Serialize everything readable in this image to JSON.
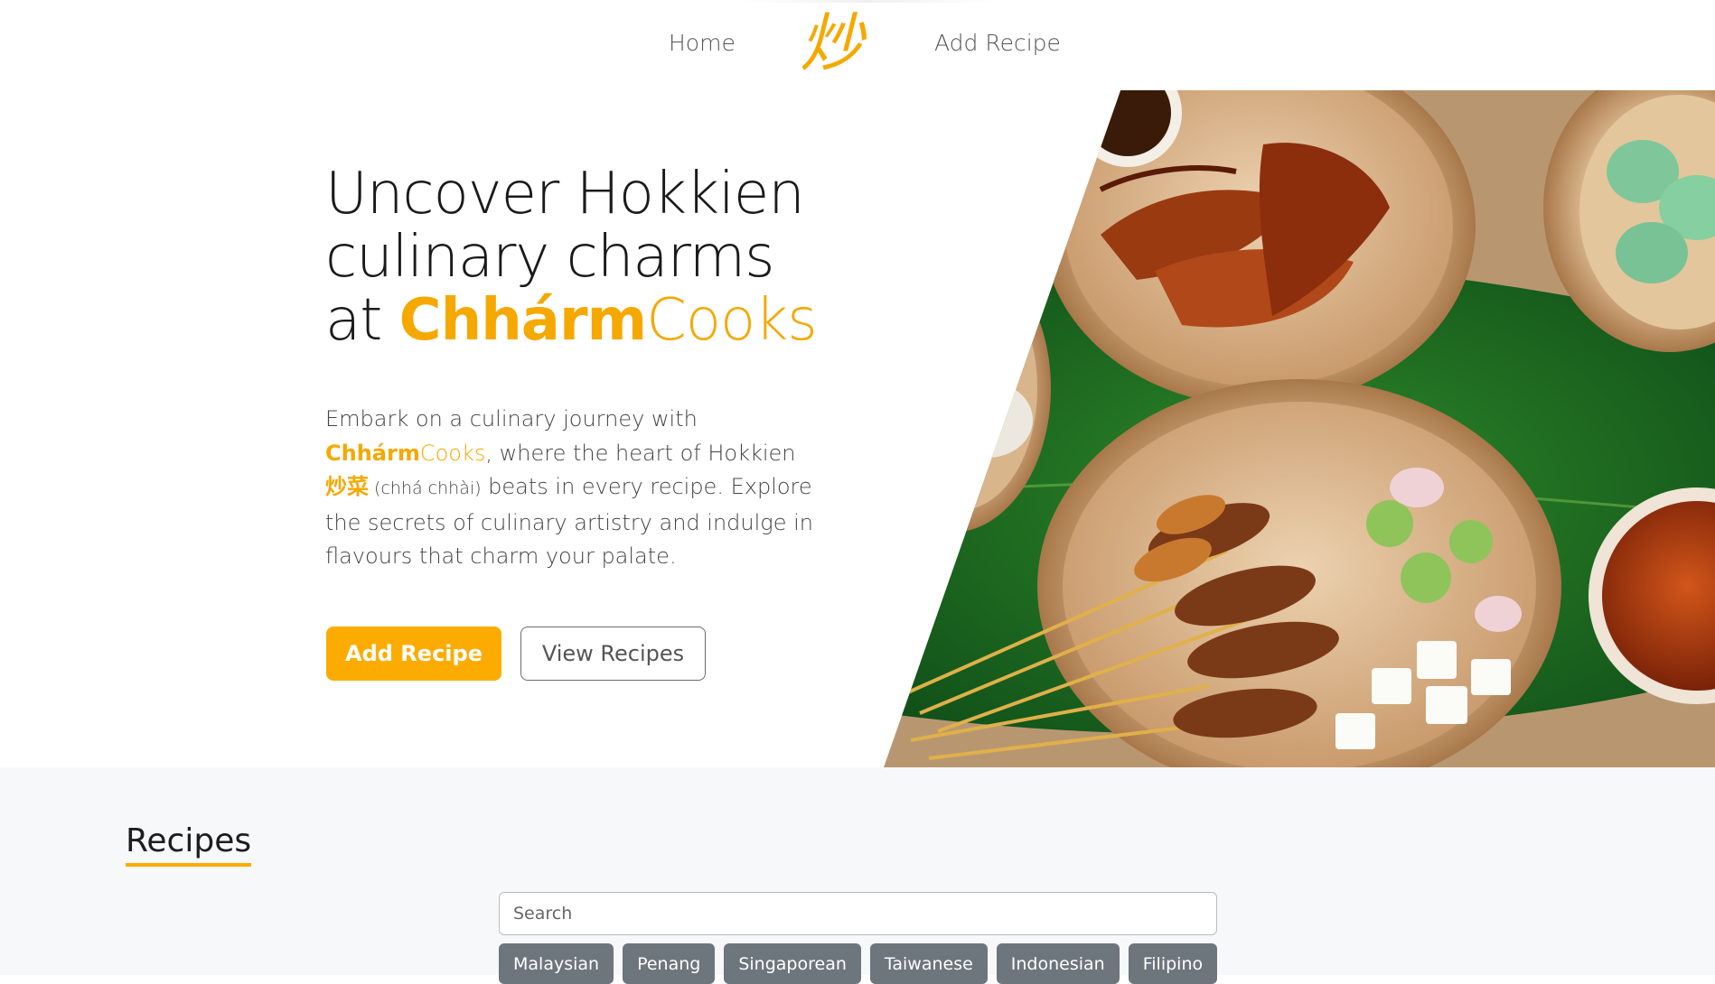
{
  "nav": {
    "home_label": "Home",
    "logo_glyph": "炒",
    "add_recipe_label": "Add Recipe"
  },
  "hero": {
    "title_line1": "Uncover Hokkien",
    "title_line2": "culinary charms",
    "title_at": "at ",
    "brand_bold": "Chhárm",
    "brand_light": "Cooks",
    "text_intro": "Embark on a culinary journey with ",
    "text_brand_bold": "Chhárm",
    "text_brand_light": "Cooks",
    "text_comma": ",",
    "text_mid": " where the heart of Hokkien ",
    "text_hanzi": "炒菜",
    "text_romanization": " (chhá chhài)",
    "text_end": " beats in every recipe. Explore the secrets of culinary artistry and indulge in flavours that charm your palate.",
    "primary_button": "Add Recipe",
    "secondary_button": "View Recipes"
  },
  "recipes": {
    "heading": "Recipes",
    "search_placeholder": "Search",
    "filters": [
      "Malaysian",
      "Penang",
      "Singaporean",
      "Taiwanese",
      "Indonesian",
      "Filipino"
    ]
  },
  "colors": {
    "accent": "#fcac00",
    "chip_bg": "#6d757d",
    "section_bg": "#f7f8f9"
  }
}
